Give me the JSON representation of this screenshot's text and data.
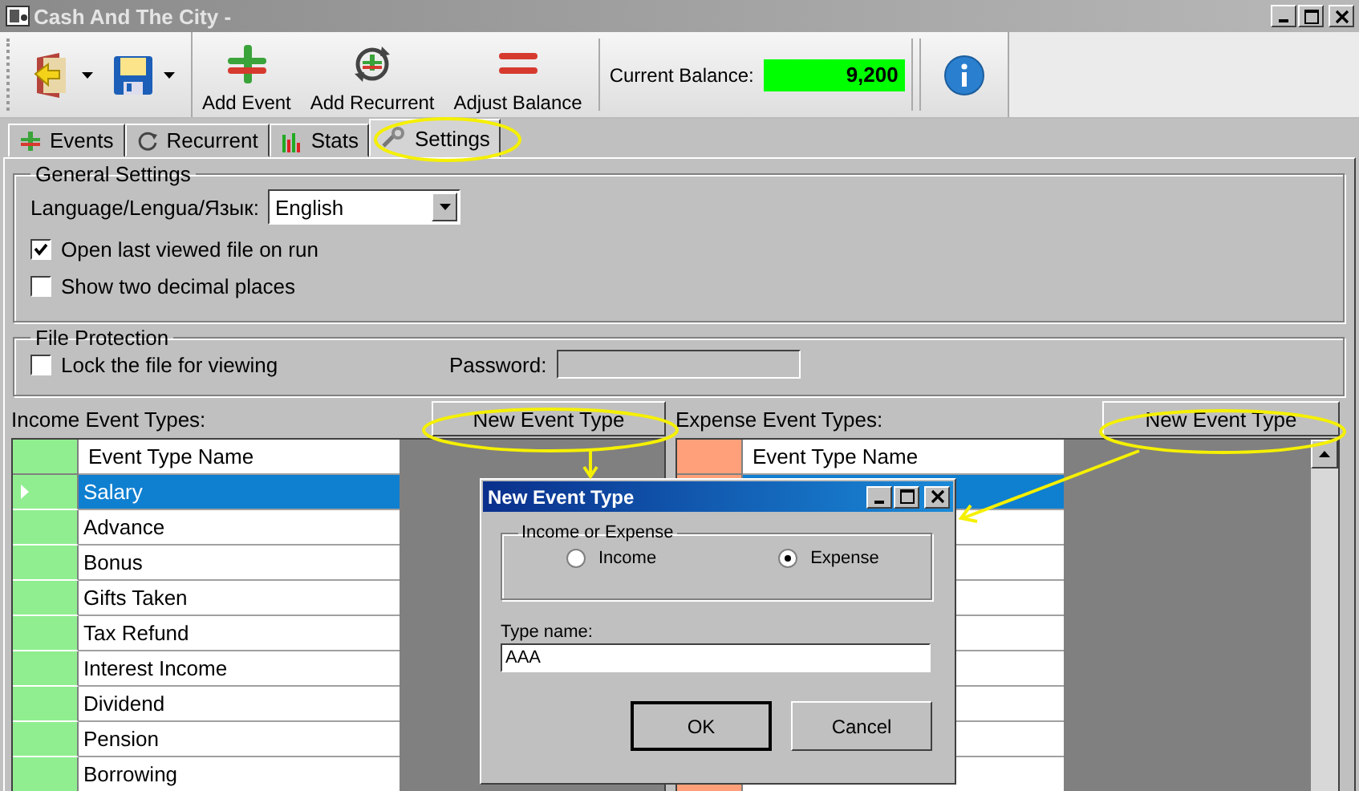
{
  "window": {
    "title": "Cash And The City -"
  },
  "toolbar": {
    "items": [
      {
        "kind": "open"
      },
      {
        "kind": "save"
      },
      {
        "kind": "add-event",
        "label": "Add Event"
      },
      {
        "kind": "add-recurrent",
        "label": "Add Recurrent"
      },
      {
        "kind": "adjust",
        "label": "Adjust Balance"
      }
    ],
    "balance": {
      "label": "Current Balance:",
      "value": "9,200"
    }
  },
  "tabs": [
    {
      "kind": "events",
      "label": "Events",
      "selected": false
    },
    {
      "kind": "recurrent",
      "label": "Recurrent",
      "selected": false
    },
    {
      "kind": "stats",
      "label": "Stats",
      "selected": false
    },
    {
      "kind": "settings",
      "label": "Settings",
      "selected": true
    }
  ],
  "general_settings": {
    "title": "General Settings",
    "language": {
      "label": "Language/Lengua/Язык:",
      "value": "English"
    },
    "checkboxes": [
      {
        "label": "Open last viewed file on run",
        "checked": true
      },
      {
        "label": "Show two decimal places",
        "checked": false
      }
    ]
  },
  "file_protection": {
    "title": "File Protection",
    "lock": {
      "label": "Lock the file for viewing",
      "checked": false
    },
    "password": {
      "label": "Password:"
    }
  },
  "income": {
    "label": "Income Event Types:",
    "button": "New Event Type",
    "column": "Event Type Name",
    "rows": [
      {
        "name": "Salary",
        "selected": true
      },
      {
        "name": "Advance",
        "selected": false
      },
      {
        "name": "Bonus",
        "selected": false
      },
      {
        "name": "Gifts Taken",
        "selected": false
      },
      {
        "name": "Tax Refund",
        "selected": false
      },
      {
        "name": "Interest Income",
        "selected": false
      },
      {
        "name": "Dividend",
        "selected": false
      },
      {
        "name": "Pension",
        "selected": false
      },
      {
        "name": "Borrowing",
        "selected": false
      }
    ]
  },
  "expense": {
    "label": "Expense Event Types:",
    "button": "New Event Type",
    "column": "Event Type Name",
    "rows": [
      {
        "selected": true
      },
      {
        "selected": false
      },
      {
        "selected": false
      },
      {
        "selected": false
      },
      {
        "selected": false
      },
      {
        "selected": false
      },
      {
        "selected": false
      },
      {
        "selected": false
      },
      {
        "selected": false
      }
    ]
  },
  "dialog": {
    "title": "New Event Type",
    "group_title": "Income or Expense",
    "options": [
      {
        "label": "Income",
        "selected": false
      },
      {
        "label": "Expense",
        "selected": true
      }
    ],
    "type_label": "Type name:",
    "value": "AAA",
    "buttons": [
      {
        "label": "OK",
        "default": true
      },
      {
        "label": "Cancel",
        "default": false
      }
    ]
  }
}
